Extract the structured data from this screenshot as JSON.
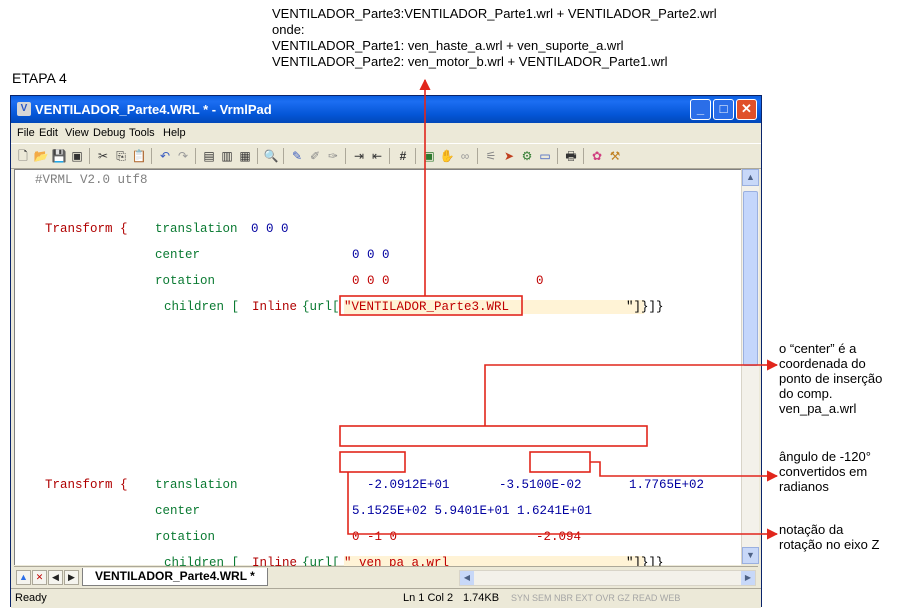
{
  "top_note": {
    "line1": "VENTILADOR_Parte3:VENTILADOR_Parte1.wrl + VENTILADOR_Parte2.wrl",
    "line2": "onde:",
    "line3": "VENTILADOR_Parte1: ven_haste_a.wrl + ven_suporte_a.wrl",
    "line4": "VENTILADOR_Parte2: ven_motor_b.wrl + VENTILADOR_Parte1.wrl"
  },
  "etapa": "ETAPA 4",
  "window": {
    "title": "VENTILADOR_Parte4.WRL * - VrmlPad",
    "minimize": "_",
    "maximize": "□",
    "close": "✕"
  },
  "menu": [
    "File",
    "Edit",
    "View",
    "Debug",
    "Tools",
    "Help"
  ],
  "code": {
    "header": "#VRML V2.0 utf8",
    "t1": {
      "transform": "Transform {",
      "translation_kw": "translation",
      "translation_val": "0 0 0",
      "center_kw": "center",
      "center_val": "0 0 0",
      "rotation_kw": "rotation",
      "rotation_val": "0 0 0",
      "rotation_angle": "0",
      "children_kw": "children [",
      "inline_kw": "Inline",
      "url_open": "{url[",
      "url_value": "\"VENTILADOR_Parte3.WRL",
      "url_close": "\"]}]}"
    },
    "t2": {
      "transform": "Transform {",
      "translation_kw": "translation",
      "tx": "-2.0912E+01",
      "ty": "-3.5100E-02",
      "tz": "1.7765E+02",
      "center_kw": "center",
      "center_val": "5.1525E+02   5.9401E+01   1.6241E+01",
      "rotation_kw": "rotation",
      "rotation_val": "0 -1 0",
      "rotation_angle": "-2.094",
      "children_kw": "children [",
      "inline_kw": "Inline",
      "url_open": "{url[",
      "url_value": "\" ven_pa_a.wrl",
      "url_close": "\"]}]}"
    }
  },
  "tab": {
    "label": "VENTILADOR_Parte4.WRL *"
  },
  "status": {
    "ready": "Ready",
    "position": "Ln 1  Col 2",
    "size": "1.74KB",
    "indicators": "SYN  SEM  NBR  EXT  OVR  GZ  READ  WEB"
  },
  "annotations": {
    "center_note": [
      "o “center” é a",
      "coordenada do",
      "ponto de inserção",
      "do comp.",
      "ven_pa_a.wrl"
    ],
    "angle_note": [
      "ângulo de -120°",
      "convertidos em",
      "radianos"
    ],
    "axis_note": [
      "notação da",
      "rotação no eixo Z"
    ]
  },
  "colors": {
    "annotation_red": "#e1261c",
    "title_blue": "#0a5fe0"
  }
}
